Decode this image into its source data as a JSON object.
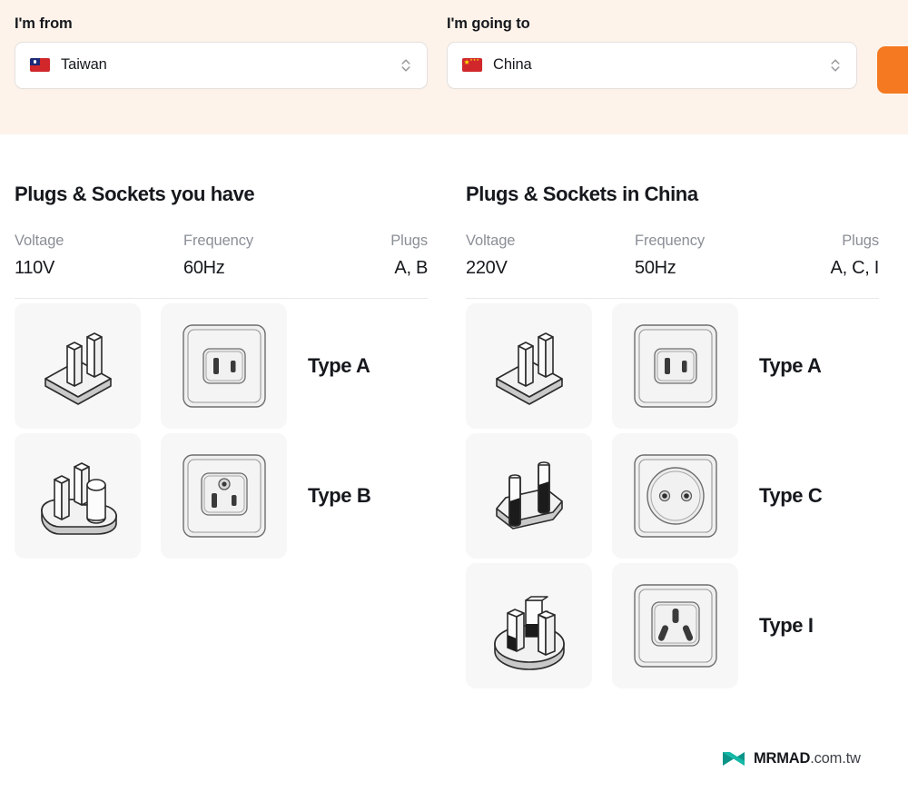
{
  "header": {
    "from": {
      "label": "I'm from",
      "country": "Taiwan",
      "flag_icon": "flag-taiwan-icon",
      "stepper_icon": "chevron-up-down-icon"
    },
    "to": {
      "label": "I'm going to",
      "country": "China",
      "flag_icon": "flag-china-icon",
      "stepper_icon": "chevron-up-down-icon"
    },
    "go_button": {
      "label": "",
      "color": "#f47920"
    },
    "background_color": "#fdf3ea"
  },
  "columns": [
    {
      "title": "Plugs & Sockets you have",
      "stats": {
        "voltage_label": "Voltage",
        "voltage_value": "110V",
        "frequency_label": "Frequency",
        "frequency_value": "60Hz",
        "plugs_label": "Plugs",
        "plugs_value": "A, B"
      },
      "rows": [
        {
          "label": "Type A",
          "plug_icon": "plug-type-a-icon",
          "socket_icon": "socket-type-a-icon"
        },
        {
          "label": "Type B",
          "plug_icon": "plug-type-b-icon",
          "socket_icon": "socket-type-b-icon"
        }
      ]
    },
    {
      "title": "Plugs & Sockets in China",
      "stats": {
        "voltage_label": "Voltage",
        "voltage_value": "220V",
        "frequency_label": "Frequency",
        "frequency_value": "50Hz",
        "plugs_label": "Plugs",
        "plugs_value": "A, C, I"
      },
      "rows": [
        {
          "label": "Type A",
          "plug_icon": "plug-type-a-icon",
          "socket_icon": "socket-type-a-icon"
        },
        {
          "label": "Type C",
          "plug_icon": "plug-type-c-icon",
          "socket_icon": "socket-type-c-icon"
        },
        {
          "label": "Type I",
          "plug_icon": "plug-type-i-icon",
          "socket_icon": "socket-type-i-icon"
        }
      ]
    }
  ],
  "brand": {
    "name": "MRMAD",
    "tld": ".com.tw",
    "mark_icon": "mrmad-logo-icon",
    "mark_color": "#0ea5a0"
  }
}
